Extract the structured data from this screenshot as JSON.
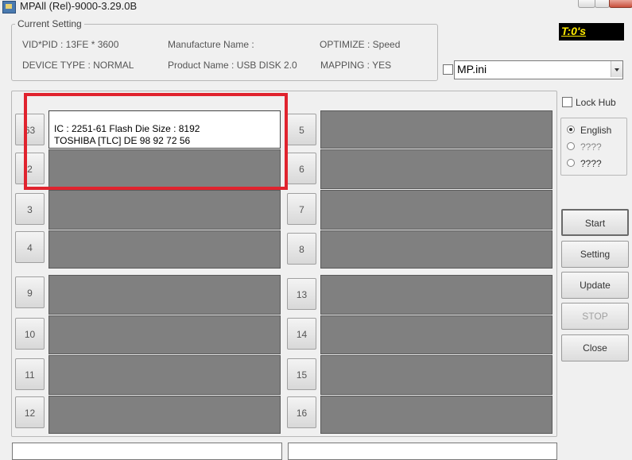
{
  "window": {
    "title": "MPAll (Rel)-9000-3.29.0B"
  },
  "current_setting": {
    "label": "Current Setting",
    "vid_pid": "VID*PID : 13FE * 3600",
    "manufacture_name": "Manufacture Name :",
    "optimize": "OPTIMIZE : Speed",
    "device_type": "DEVICE TYPE : NORMAL",
    "product_name": "Product Name : USB DISK 2.0",
    "mapping": "MAPPING : YES"
  },
  "timer": "T:0's",
  "ini_combo": {
    "value": "MP.ini"
  },
  "lock_hub": {
    "label": "Lock Hub",
    "checked": false
  },
  "language": {
    "options": [
      {
        "label": "English",
        "selected": true
      },
      {
        "label": "????",
        "selected": false
      },
      {
        "label": "????",
        "selected": false
      }
    ]
  },
  "buttons": {
    "start": "Start",
    "setting": "Setting",
    "update": "Update",
    "stop": "STOP",
    "close": "Close"
  },
  "ports": {
    "left": [
      {
        "label": "63",
        "active": true,
        "line1": "IC : 2251-61  Flash Die Size : 8192",
        "line2": "TOSHIBA [TLC] DE 98 92 72 56"
      },
      {
        "label": "2"
      },
      {
        "label": "3"
      },
      {
        "label": "4"
      },
      {
        "label": "9"
      },
      {
        "label": "10"
      },
      {
        "label": "11"
      },
      {
        "label": "12"
      }
    ],
    "right": [
      {
        "label": "5"
      },
      {
        "label": "6"
      },
      {
        "label": "7"
      },
      {
        "label": "8"
      },
      {
        "label": "13"
      },
      {
        "label": "14"
      },
      {
        "label": "15"
      },
      {
        "label": "16"
      }
    ]
  },
  "colors": {
    "highlight": "#e0232e",
    "slot_idle": "#808080",
    "timer_bg": "#000000",
    "timer_text": "#ffea00"
  }
}
